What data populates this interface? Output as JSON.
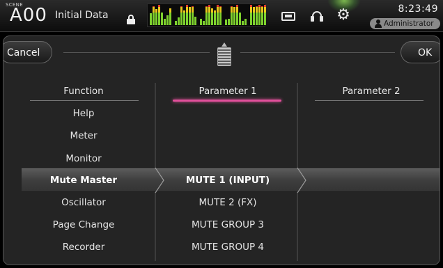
{
  "header": {
    "scene_tag": "SCENE",
    "scene_number": "A00",
    "scene_name": "Initial Data",
    "time": "8:23:49",
    "user": "Administrator"
  },
  "meters": {
    "columns": [
      {
        "level": 0.55
      },
      {
        "level": 0.9
      },
      {
        "level": 0.75
      },
      {
        "level": 0.95
      },
      {
        "level": 0.6
      },
      {
        "level": 0.3
      },
      {
        "level": 0.45
      },
      {
        "level": 0.8
      },
      {
        "level": 0.2
      },
      {
        "level": 0.35
      },
      {
        "level": 0.9
      },
      {
        "level": 0.7
      },
      {
        "level": 0.95
      },
      {
        "level": 0.85
      },
      {
        "level": 0.9
      },
      {
        "level": 0.4
      },
      {
        "level": 0.3
      },
      {
        "level": 0.2
      },
      {
        "level": 0.9
      },
      {
        "level": 0.95
      },
      {
        "level": 0.8
      },
      {
        "level": 0.7
      },
      {
        "level": 0.95
      },
      {
        "level": 0.9
      },
      {
        "level": 0.25
      },
      {
        "level": 0.3
      },
      {
        "level": 0.9
      },
      {
        "level": 0.85
      },
      {
        "level": 0.95
      },
      {
        "level": 0.6
      },
      {
        "level": 0.2
      },
      {
        "level": 0.3
      },
      {
        "level": 0.95
      },
      {
        "level": 0.85
      },
      {
        "level": 0.9
      },
      {
        "level": 0.95
      },
      {
        "level": 0.9
      },
      {
        "level": 0.95
      }
    ],
    "colors": {
      "low": "#7ed12e",
      "mid": "#e8c81c",
      "high": "#e03c2c"
    }
  },
  "dialog": {
    "cancel_label": "Cancel",
    "ok_label": "OK",
    "columns": {
      "function": {
        "header": "Function",
        "items": [
          "Help",
          "Meter",
          "Monitor",
          "Mute Master",
          "Oscillator",
          "Page Change",
          "Recorder"
        ],
        "selected": "Mute Master"
      },
      "parameter1": {
        "header": "Parameter 1",
        "items": [
          "MUTE 1 (INPUT)",
          "MUTE 2 (FX)",
          "MUTE GROUP 3",
          "MUTE GROUP 4"
        ],
        "selected": "MUTE 1 (INPUT)"
      },
      "parameter2": {
        "header": "Parameter 2",
        "items": []
      }
    }
  },
  "colors": {
    "accent": "#e0509a",
    "selection_band": "#4a4a4a"
  }
}
